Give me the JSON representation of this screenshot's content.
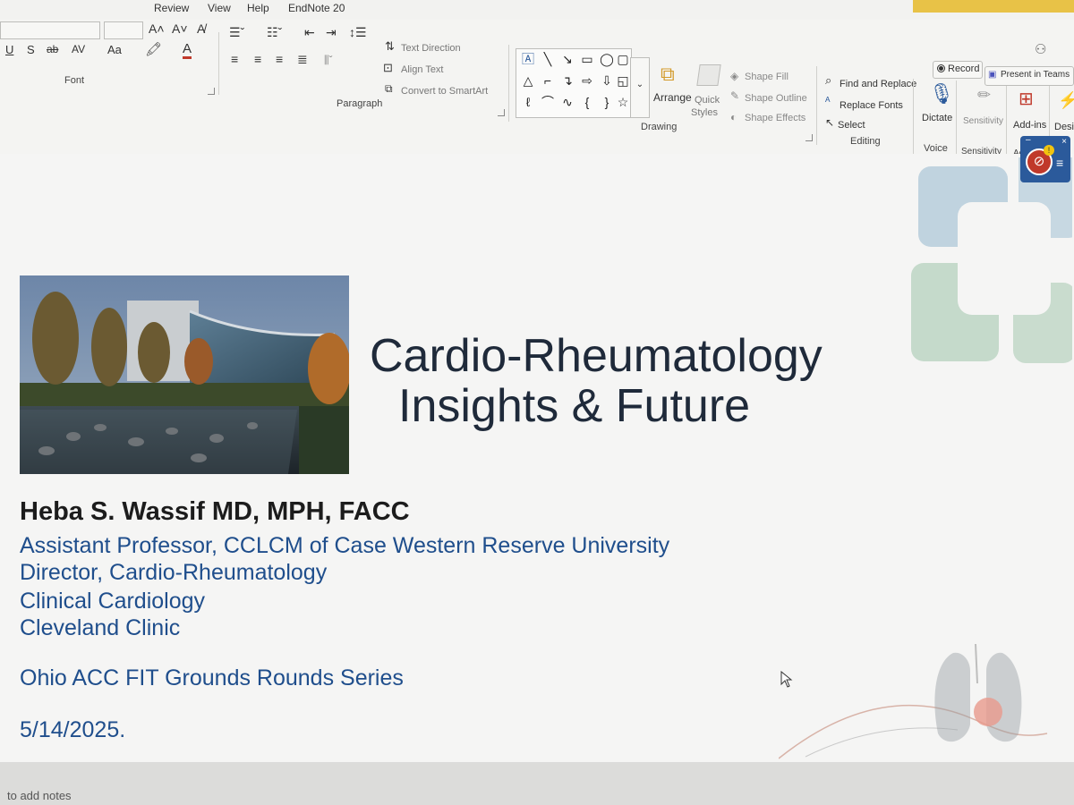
{
  "menubar": {
    "tabs": [
      "Review",
      "View",
      "Help",
      "EndNote 20"
    ]
  },
  "ribbon": {
    "font": {
      "group_label": "Font",
      "btn_strike": "ab",
      "btn_spacing": "AV",
      "btn_case": "Aa",
      "btn_underline": "U",
      "btn_shadow": "S"
    },
    "paragraph": {
      "group_label": "Paragraph",
      "text_direction": "Text Direction",
      "align_text": "Align Text",
      "convert_smartart": "Convert to SmartArt"
    },
    "drawing": {
      "group_label": "Drawing",
      "arrange": "Arrange",
      "quick_styles_1": "Quick",
      "quick_styles_2": "Styles",
      "shape_fill": "Shape Fill",
      "shape_outline": "Shape Outline",
      "shape_effects": "Shape Effects"
    },
    "editing": {
      "group_label": "Editing",
      "find_replace": "Find and Replace",
      "replace_fonts": "Replace Fonts",
      "select": "Select"
    },
    "voice": {
      "group_label": "Voice",
      "dictate": "Dictate"
    },
    "sensitivity": {
      "group_label": "Sensitivity",
      "button": "Sensitivity"
    },
    "addins": {
      "group_label": "Ac",
      "button": "Add-ins"
    },
    "designer": {
      "button": "Desig"
    },
    "record": "Record",
    "present_teams": "Present in Teams"
  },
  "slide": {
    "title_line1": "Cardio-Rheumatology",
    "title_line2": "Insights & Future",
    "presenter": "Heba S. Wassif MD, MPH, FACC",
    "affiliations": [
      "Assistant Professor, CCLCM of Case Western Reserve University",
      "Director, Cardio-Rheumatology",
      "Clinical Cardiology",
      "Cleveland Clinic"
    ],
    "series": "Ohio ACC FIT Grounds Rounds Series",
    "date": "5/14/2025."
  },
  "notes": {
    "placeholder": "to add notes"
  },
  "colors": {
    "title_text": "#1f2a3a",
    "affiliation_text": "#1f4e8c",
    "logo_blue": "#a9c4d6",
    "logo_green": "#b9d3c1",
    "record_red": "#c0392b"
  }
}
